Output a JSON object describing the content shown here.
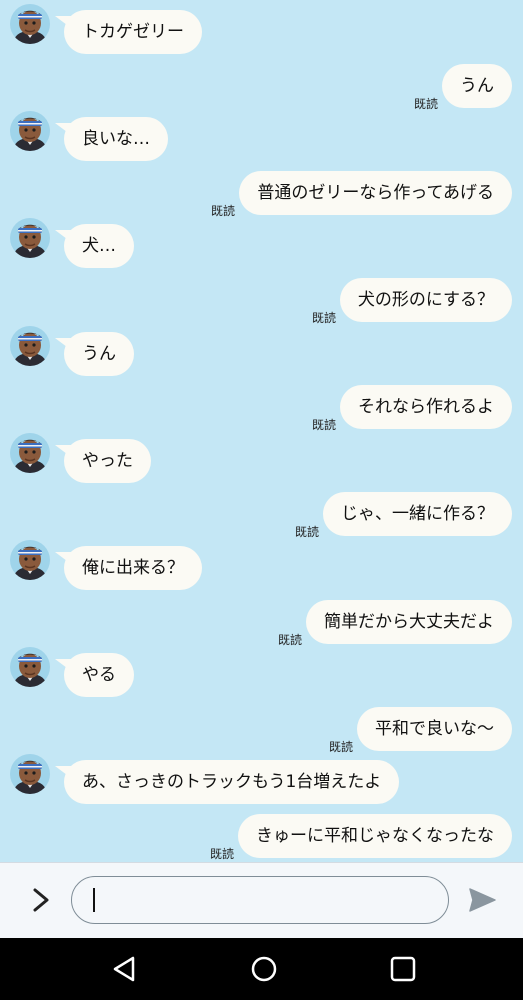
{
  "chat": {
    "read_label": "既読",
    "messages": [
      {
        "side": "in",
        "text": "トカゲゼリー"
      },
      {
        "side": "out",
        "text": "うん"
      },
      {
        "side": "in",
        "text": "良いな…"
      },
      {
        "side": "out",
        "text": "普通のゼリーなら作ってあげる"
      },
      {
        "side": "in",
        "text": "犬…"
      },
      {
        "side": "out",
        "text": "犬の形のにする？"
      },
      {
        "side": "in",
        "text": "うん"
      },
      {
        "side": "out",
        "text": "それなら作れるよ"
      },
      {
        "side": "in",
        "text": "やった"
      },
      {
        "side": "out",
        "text": "じゃ、一緒に作る？"
      },
      {
        "side": "in",
        "text": "俺に出来る？"
      },
      {
        "side": "out",
        "text": "簡単だから大丈夫だよ"
      },
      {
        "side": "in",
        "text": "やる"
      },
      {
        "side": "out",
        "text": "平和で良いな〜"
      },
      {
        "side": "in",
        "text": "あ、さっきのトラックもう1台増えたよ"
      },
      {
        "side": "out",
        "text": "きゅーに平和じゃなくなったな"
      }
    ]
  },
  "input": {
    "value": "",
    "placeholder": ""
  },
  "icons": {
    "expand": "chevron-right-icon",
    "send": "send-icon",
    "nav_back": "back-triangle-icon",
    "nav_home": "home-circle-icon",
    "nav_recents": "recents-square-icon"
  },
  "colors": {
    "background": "#c4e7f5",
    "bubble": "#fbfaf4",
    "input_bar": "#f4f7fa",
    "nav_bar": "#000000"
  }
}
